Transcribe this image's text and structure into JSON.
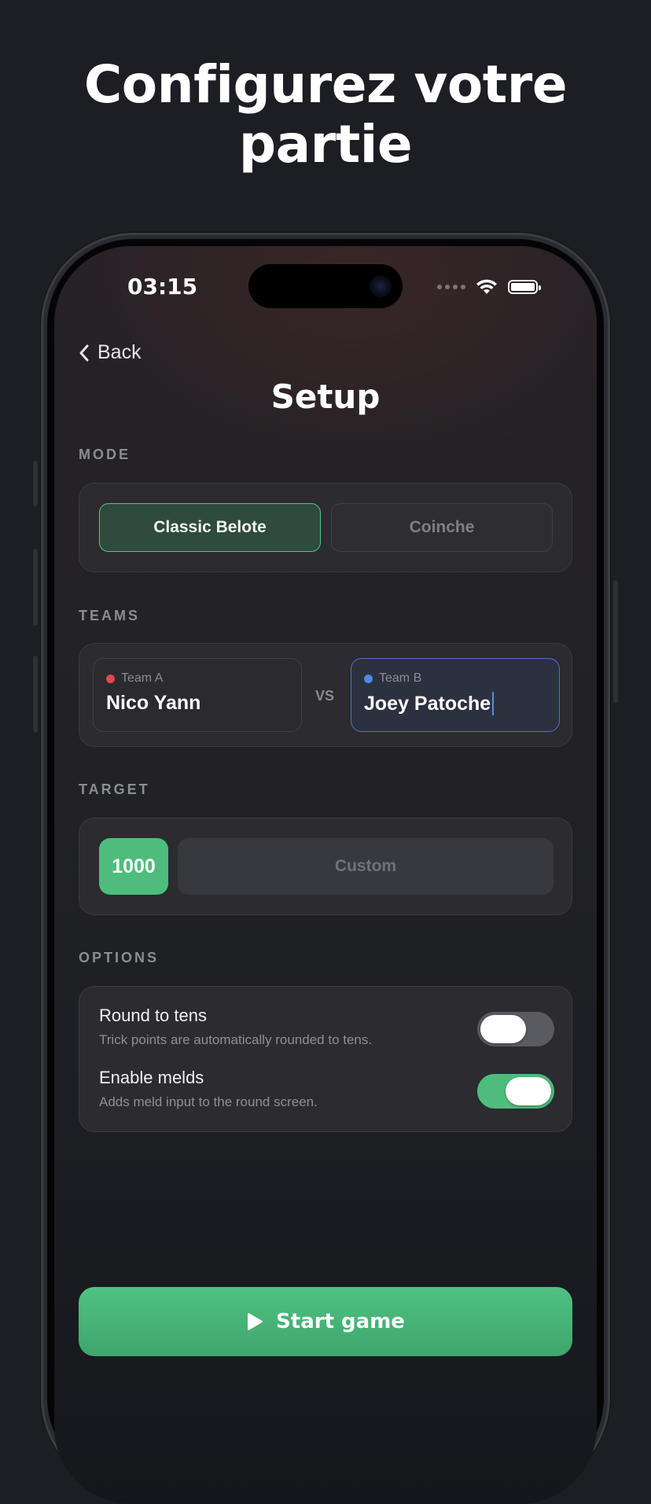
{
  "headline": {
    "line1": "Configurez votre",
    "line2": "partie"
  },
  "status_bar": {
    "time": "03:15",
    "icons": [
      "signal-dots-icon",
      "wifi-icon",
      "battery-icon"
    ]
  },
  "nav": {
    "back_label": "Back",
    "title": "Setup"
  },
  "mode": {
    "section_label": "MODE",
    "options": [
      "Classic Belote",
      "Coinche"
    ],
    "selected": "Classic Belote"
  },
  "teams": {
    "section_label": "TEAMS",
    "team_a": {
      "tag": "Team A",
      "name": "Nico Yann",
      "color": "#e5484d"
    },
    "vs_label": "VS",
    "team_b": {
      "tag": "Team B",
      "name": "Joey Patoche",
      "color": "#4c8be0"
    }
  },
  "target": {
    "section_label": "TARGET",
    "selected_value": "1000",
    "custom_label": "Custom"
  },
  "options": {
    "section_label": "OPTIONS",
    "round_to_tens": {
      "title": "Round to tens",
      "description": "Trick points are automatically rounded to tens.",
      "enabled": false
    },
    "enable_melds": {
      "title": "Enable melds",
      "description": "Adds meld input to the round screen.",
      "enabled": true
    }
  },
  "start_button": {
    "label": "Start game",
    "icon": "play-icon"
  },
  "colors": {
    "accent_green": "#4ebd7c",
    "team_a_red": "#e5484d",
    "team_b_blue": "#4c8be0",
    "background": "#1d1e24"
  }
}
